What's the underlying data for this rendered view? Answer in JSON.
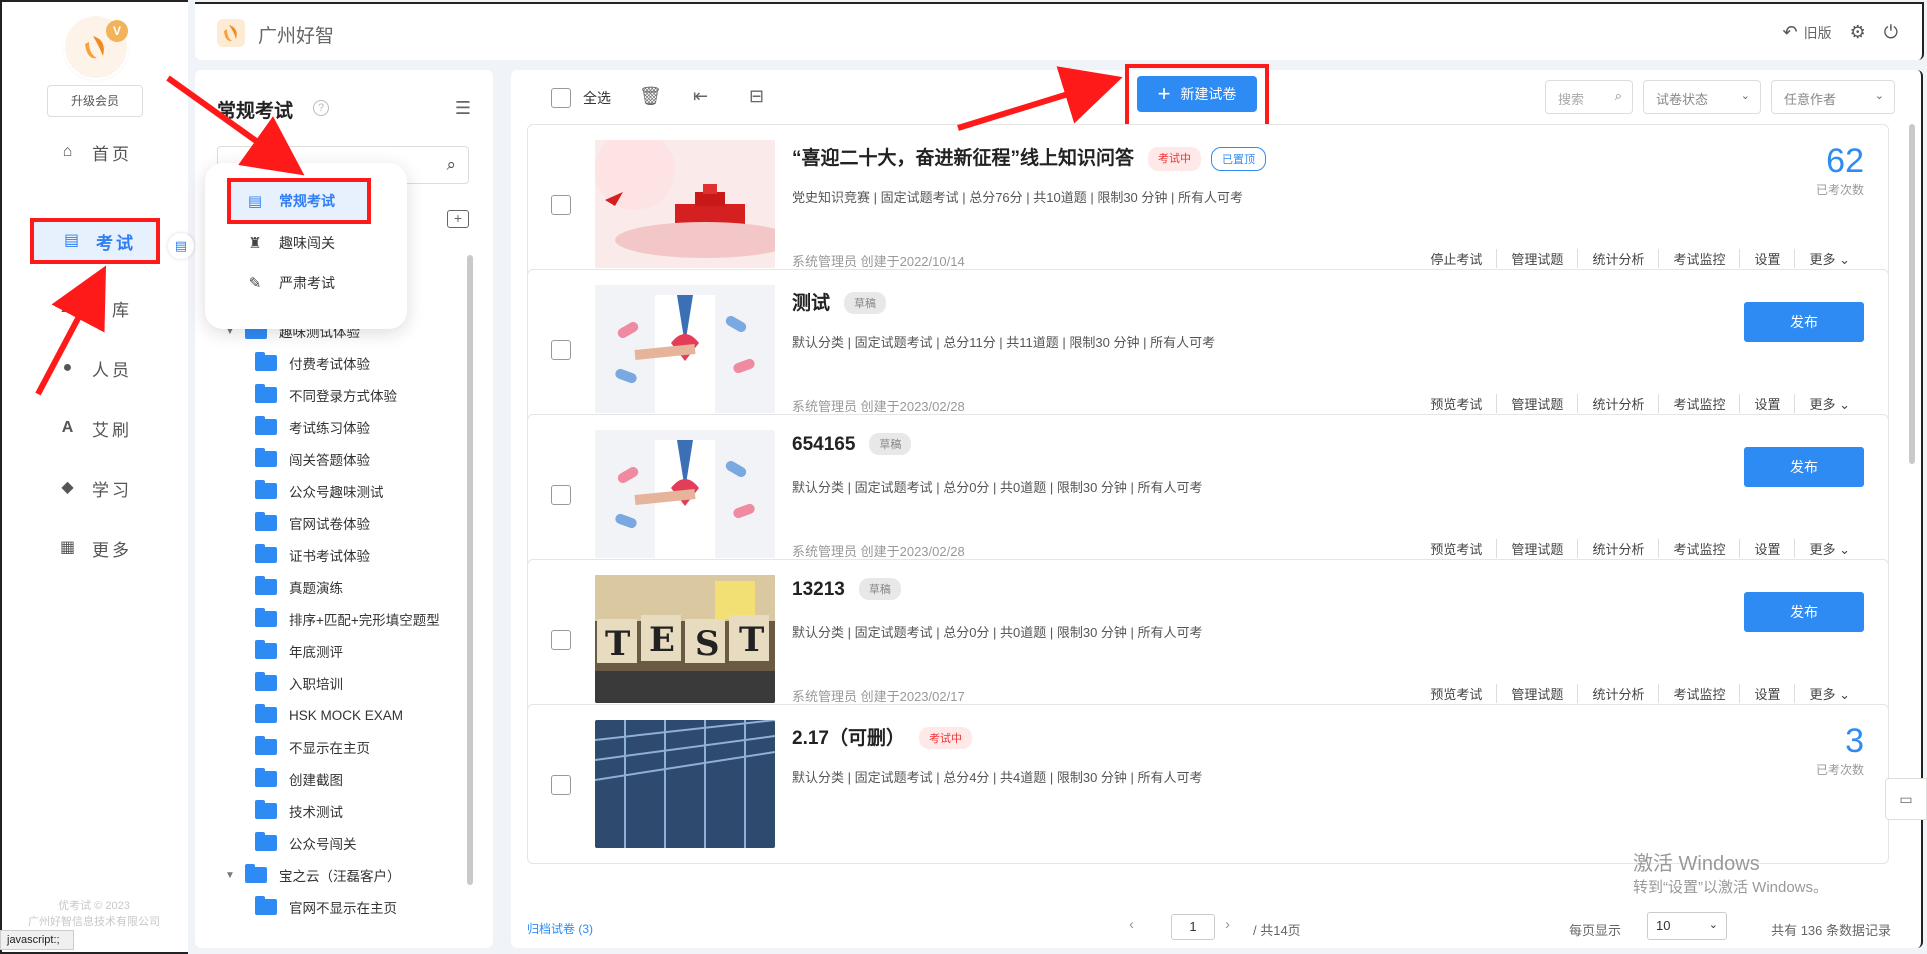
{
  "nav": {
    "vip_badge": "V",
    "upgrade_label": "升级会员",
    "items": [
      {
        "label": "首页",
        "icon": "home-icon"
      },
      {
        "label": "考试",
        "icon": "exam-icon"
      },
      {
        "label": "库",
        "icon": "bank-icon"
      },
      {
        "label": "人员",
        "icon": "person-icon"
      },
      {
        "label": "艾刷",
        "icon": "brush-icon"
      },
      {
        "label": "学习",
        "icon": "graduation-cap-icon"
      },
      {
        "label": "更多",
        "icon": "grid-icon"
      }
    ],
    "footer_line1": "优考试 © 2023",
    "footer_line2": "广州好智信息技术有限公司"
  },
  "status_bar": "javascript:;",
  "header": {
    "brand": "广州好智",
    "old_version": "旧版"
  },
  "category": {
    "title": "常规考试",
    "help": "?",
    "tree": [
      {
        "label": "趣味测试体验",
        "caret": "▼",
        "level": 0
      },
      {
        "label": "付费考试体验",
        "level": 1
      },
      {
        "label": "不同登录方式体验",
        "level": 1
      },
      {
        "label": "考试练习体验",
        "level": 1
      },
      {
        "label": "闯关答题体验",
        "level": 1
      },
      {
        "label": "公众号趣味测试",
        "level": 1
      },
      {
        "label": "官网试卷体验",
        "level": 1
      },
      {
        "label": "证书考试体验",
        "level": 1
      },
      {
        "label": "真题演练",
        "level": 1
      },
      {
        "label": "排序+匹配+完形填空题型",
        "level": 1
      },
      {
        "label": "年底测评",
        "level": 1
      },
      {
        "label": "入职培训",
        "level": 1
      },
      {
        "label": "HSK MOCK EXAM",
        "level": 1
      },
      {
        "label": "不显示在主页",
        "level": 1
      },
      {
        "label": "创建截图",
        "level": 1
      },
      {
        "label": "技术测试",
        "level": 1
      },
      {
        "label": "公众号闯关",
        "level": 1
      },
      {
        "label": "宝之云（汪磊客户）",
        "caret": "▼",
        "level": 0
      },
      {
        "label": "官网不显示在主页",
        "level": 1
      }
    ]
  },
  "popup": {
    "items": [
      {
        "label": "常规考试",
        "icon": "document-icon"
      },
      {
        "label": "趣味闯关",
        "icon": "trophy-icon"
      },
      {
        "label": "严肃考试",
        "icon": "seal-icon"
      }
    ]
  },
  "toolbar": {
    "select_all": "全选",
    "new_paper": "新建试卷",
    "search_placeholder": "搜索",
    "status_filter": "试卷状态",
    "author_filter": "任意作者"
  },
  "cards": [
    {
      "title": "“喜迎二十大，奋进新征程”线上知识问答",
      "tags": [
        {
          "label": "考试中",
          "kind": "running"
        },
        {
          "label": "已置顶",
          "kind": "pinned"
        }
      ],
      "meta": "党史知识竞赛 | 固定试题考试 | 总分76分 | 共10道题 | 限制30 分钟 | 所有人可考",
      "foot": "系统管理员 创建于2022/10/14",
      "actions": [
        "停止考试",
        "管理试题",
        "统计分析",
        "考试监控",
        "设置",
        "更多 ⌄"
      ],
      "count": "62",
      "count_label": "已考次数",
      "thumb": "party"
    },
    {
      "title": "测试",
      "tags": [
        {
          "label": "草稿",
          "kind": "draft"
        }
      ],
      "meta": "默认分类 | 固定试题考试 | 总分11分 | 共11道题 | 限制30 分钟 | 所有人可考",
      "foot": "系统管理员 创建于2023/02/28",
      "actions": [
        "预览考试",
        "管理试题",
        "统计分析",
        "考试监控",
        "设置",
        "更多 ⌄"
      ],
      "publish": "发布",
      "thumb": "doctor"
    },
    {
      "title": "654165",
      "tags": [
        {
          "label": "草稿",
          "kind": "draft"
        }
      ],
      "meta": "默认分类 | 固定试题考试 | 总分0分 | 共0道题 | 限制30 分钟 | 所有人可考",
      "foot": "系统管理员 创建于2023/02/28",
      "actions": [
        "预览考试",
        "管理试题",
        "统计分析",
        "考试监控",
        "设置",
        "更多 ⌄"
      ],
      "publish": "发布",
      "thumb": "doctor"
    },
    {
      "title": "13213",
      "tags": [
        {
          "label": "草稿",
          "kind": "draft"
        }
      ],
      "meta": "默认分类 | 固定试题考试 | 总分0分 | 共0道题 | 限制30 分钟 | 所有人可考",
      "foot": "系统管理员 创建于2023/02/17",
      "actions": [
        "预览考试",
        "管理试题",
        "统计分析",
        "考试监控",
        "设置",
        "更多 ⌄"
      ],
      "publish": "发布",
      "thumb": "test"
    },
    {
      "title": "2.17（可删）",
      "tags": [
        {
          "label": "考试中",
          "kind": "running"
        }
      ],
      "meta": "默认分类 | 固定试题考试 | 总分4分 | 共4道题 | 限制30 分钟 | 所有人可考",
      "foot": "",
      "actions": [],
      "count": "3",
      "count_label": "已考次数",
      "thumb": "building"
    }
  ],
  "pager": {
    "archived": "归档试卷 (3)",
    "current_page": "1",
    "total_pages": "/ 共14页",
    "per_page_label": "每页显示",
    "per_page": "10",
    "records": "共有 136 条数据记录"
  },
  "watermark": {
    "line1": "激活 Windows",
    "line2": "转到“设置”以激活 Windows。"
  },
  "colors": {
    "accent": "#2f8bf4",
    "highlight": "#ff1a1a",
    "running_tag": "#e33333"
  }
}
